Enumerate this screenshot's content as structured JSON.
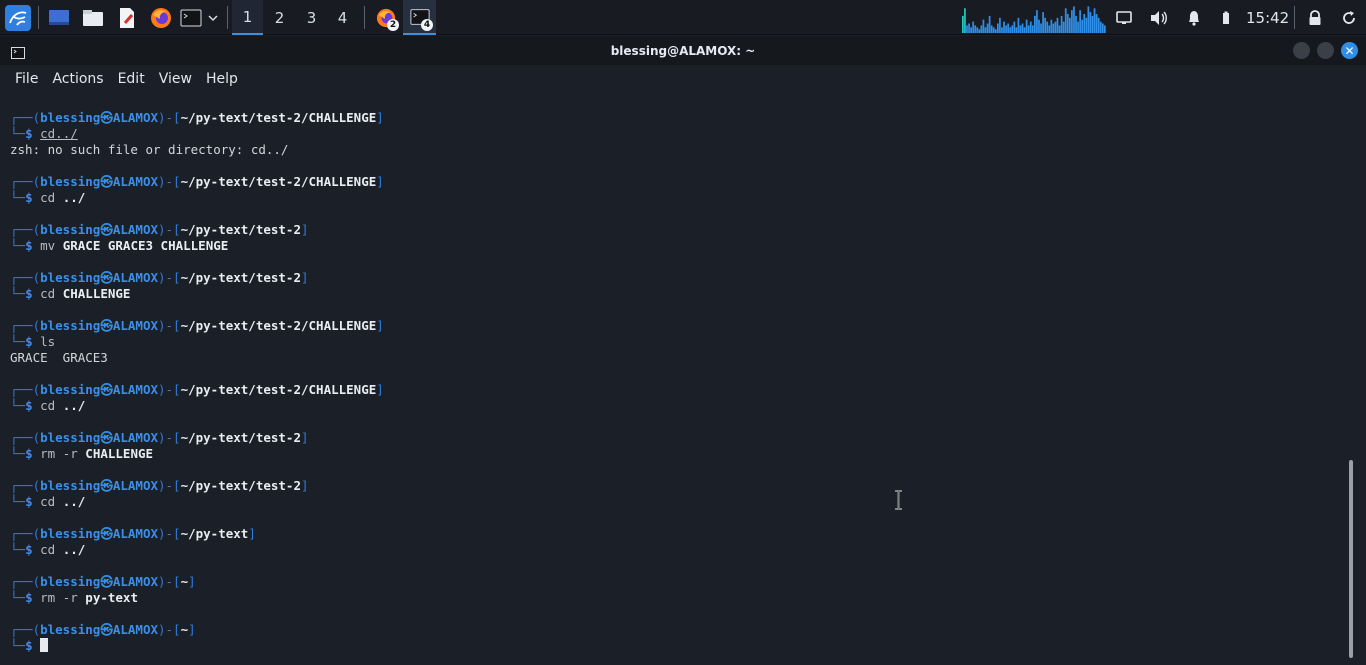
{
  "panel": {
    "workspaces": [
      "1",
      "2",
      "3",
      "4"
    ],
    "active_workspace": "1",
    "badge_firefox": "2",
    "badge_terminal": "4",
    "clock": "15:42"
  },
  "window": {
    "title": "blessing@ALAMOX: ~",
    "menu": [
      "File",
      "Actions",
      "Edit",
      "View",
      "Help"
    ]
  },
  "terminal": {
    "user": "blessing",
    "host": "ALAMOX",
    "blocks": [
      {
        "path": "~/py-text/test-2/CHALLENGE",
        "cmd": "cd../",
        "args": "",
        "output": [
          "zsh: no such file or directory: cd../"
        ]
      },
      {
        "path": "~/py-text/test-2/CHALLENGE",
        "cmd": "cd",
        "args": "../",
        "output": []
      },
      {
        "path": "~/py-text/test-2",
        "cmd": "mv",
        "args": "GRACE GRACE3 CHALLENGE",
        "output": []
      },
      {
        "path": "~/py-text/test-2",
        "cmd": "cd",
        "args": "CHALLENGE",
        "output": []
      },
      {
        "path": "~/py-text/test-2/CHALLENGE",
        "cmd": "ls",
        "args": "",
        "output": [
          "GRACE  GRACE3"
        ]
      },
      {
        "path": "~/py-text/test-2/CHALLENGE",
        "cmd": "cd",
        "args": "../",
        "output": []
      },
      {
        "path": "~/py-text/test-2",
        "cmd": "rm -r",
        "args": "CHALLENGE",
        "output": []
      },
      {
        "path": "~/py-text/test-2",
        "cmd": "cd",
        "args": "../",
        "output": []
      },
      {
        "path": "~/py-text",
        "cmd": "cd",
        "args": "../",
        "output": []
      },
      {
        "path": "~",
        "cmd": "rm -r",
        "args": "py-text",
        "output": []
      },
      {
        "path": "~",
        "cmd": "",
        "args": "",
        "output": []
      }
    ]
  },
  "colors": {
    "accent": "#3b8eea",
    "terminal_bg": "#1b1f27",
    "panel_bg": "#181b21"
  }
}
